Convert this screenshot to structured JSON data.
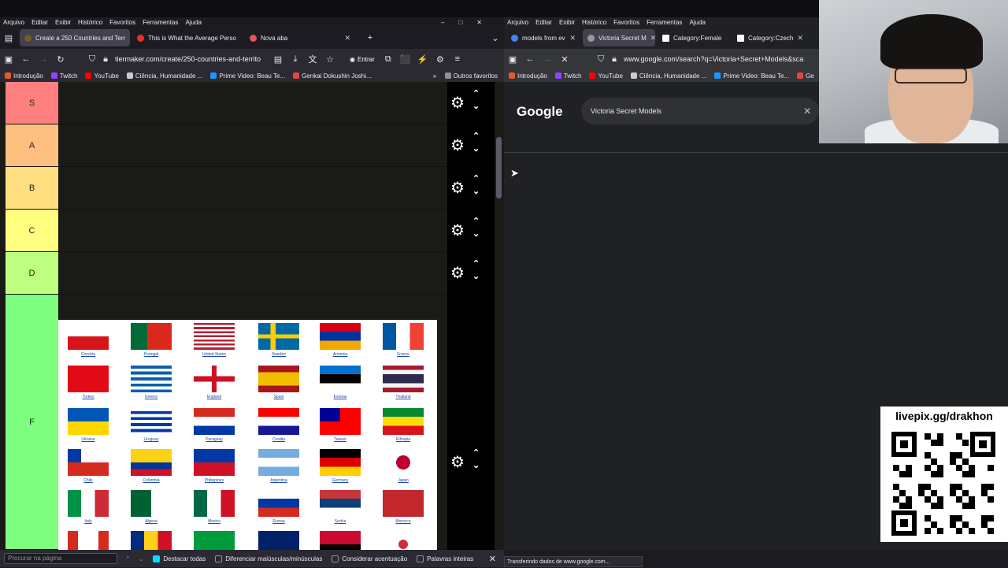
{
  "left_window": {
    "menu": [
      "Arquivo",
      "Editar",
      "Exibir",
      "Histórico",
      "Favoritos",
      "Ferramentas",
      "Ajuda"
    ],
    "tabs": [
      {
        "label": "Create a 250 Countries and Terr",
        "active": true
      },
      {
        "label": "This is What the Average Perso",
        "active": false
      },
      {
        "label": "Nova aba",
        "active": false
      }
    ],
    "url": "tiermaker.com/create/250-countries-and-territo",
    "login_label": "Entrar",
    "bookmarks": [
      "Introdução",
      "Twitch",
      "YouTube",
      "Ciência, Humanidade ...",
      "Prime Video: Beau Te...",
      "Genkai Dokushin Joshi..."
    ],
    "other_bookmarks": "Outros favoritos",
    "tiers": [
      {
        "label": "S",
        "color": "#ff7f7f"
      },
      {
        "label": "A",
        "color": "#ffbf7f"
      },
      {
        "label": "B",
        "color": "#ffdf7f"
      },
      {
        "label": "C",
        "color": "#ffff7f"
      },
      {
        "label": "D",
        "color": "#bfff7f"
      },
      {
        "label": "F",
        "color": "#7fff7f"
      }
    ],
    "flags": [
      "Czechia",
      "Portugal",
      "United States",
      "Sweden",
      "Armenia",
      "France",
      "Turkey",
      "Greece",
      "England",
      "Spain",
      "Estonia",
      "Thailand",
      "Ukraine",
      "Uruguay",
      "Paraguay",
      "Croatia",
      "Taiwan",
      "Ethiopia",
      "Chile",
      "Colombia",
      "Philippines",
      "Argentina",
      "Germany",
      "Japan",
      "Italy",
      "Algeria",
      "Mexico",
      "Russia",
      "Serbia",
      "Morocco"
    ],
    "find": {
      "placeholder": "Procurar na página",
      "options": [
        "Destacar todas",
        "Diferenciar maiúsculas/minúsculas",
        "Considerar acentuação",
        "Palavras inteiras"
      ]
    }
  },
  "right_window": {
    "menu": [
      "Arquivo",
      "Editar",
      "Exibir",
      "Histórico",
      "Favoritos",
      "Ferramentas",
      "Ajuda"
    ],
    "tabs": [
      {
        "label": "models from ev",
        "active": false
      },
      {
        "label": "Victoria Secret M",
        "active": true
      },
      {
        "label": "Category:Female",
        "active": false
      },
      {
        "label": "Category:Czech",
        "active": false
      }
    ],
    "url": "www.google.com/search?q=Victoria+Secret+Models&sca",
    "bookmarks": [
      "Introdução",
      "Twitch",
      "YouTube",
      "Ciência, Humanidade ...",
      "Prime Video: Beau Te...",
      "Ge"
    ],
    "logo": "Google",
    "search_value": "Victoria Secret Models",
    "status": "Transferindo dados de www.google.com..."
  },
  "overlay": {
    "qr_text": "livepix.gg/drakhon"
  }
}
